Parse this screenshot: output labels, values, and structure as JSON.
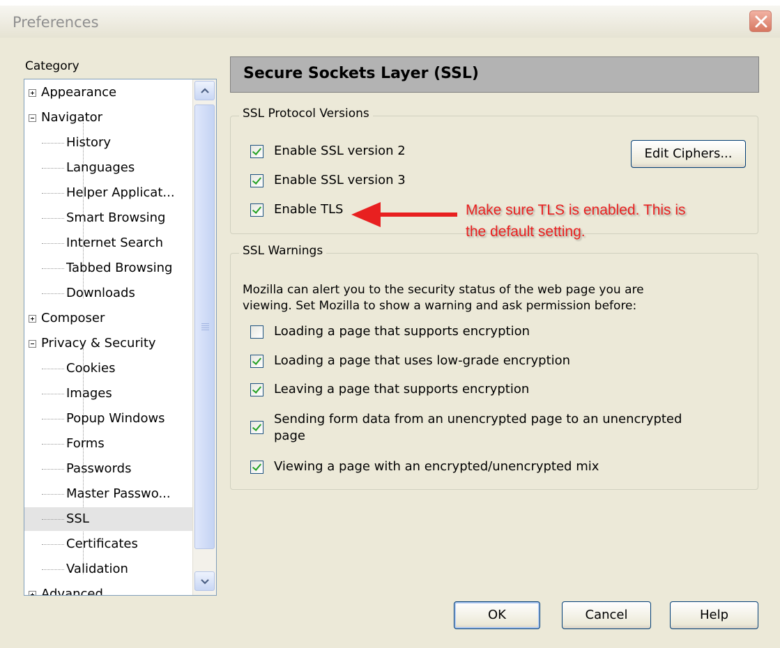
{
  "window": {
    "title": "Preferences"
  },
  "sidebar": {
    "label": "Category",
    "items": [
      {
        "label": "Appearance",
        "kind": "plus"
      },
      {
        "label": "Navigator",
        "kind": "minus"
      },
      {
        "label": "History",
        "kind": "child"
      },
      {
        "label": "Languages",
        "kind": "child"
      },
      {
        "label": "Helper Applicat...",
        "kind": "child"
      },
      {
        "label": "Smart Browsing",
        "kind": "child"
      },
      {
        "label": "Internet Search",
        "kind": "child"
      },
      {
        "label": "Tabbed Browsing",
        "kind": "child"
      },
      {
        "label": "Downloads",
        "kind": "child"
      },
      {
        "label": "Composer",
        "kind": "plus"
      },
      {
        "label": "Privacy & Security",
        "kind": "minus"
      },
      {
        "label": "Cookies",
        "kind": "child"
      },
      {
        "label": "Images",
        "kind": "child"
      },
      {
        "label": "Popup Windows",
        "kind": "child"
      },
      {
        "label": "Forms",
        "kind": "child"
      },
      {
        "label": "Passwords",
        "kind": "child"
      },
      {
        "label": "Master Passwo...",
        "kind": "child"
      },
      {
        "label": "SSL",
        "kind": "child",
        "selected": true
      },
      {
        "label": "Certificates",
        "kind": "child"
      },
      {
        "label": "Validation",
        "kind": "child"
      },
      {
        "label": "Advanced",
        "kind": "plus"
      }
    ]
  },
  "panel": {
    "title": "Secure Sockets Layer (SSL)",
    "protocols": {
      "legend": "SSL Protocol Versions",
      "edit_ciphers": "Edit Ciphers...",
      "options": [
        {
          "label": "Enable SSL version 2",
          "checked": true
        },
        {
          "label": "Enable SSL version 3",
          "checked": true
        },
        {
          "label": "Enable TLS",
          "checked": true
        }
      ]
    },
    "warnings": {
      "legend": "SSL Warnings",
      "description_line1": "Mozilla can alert you to the security status of the web page you are",
      "description_line2": "viewing. Set Mozilla to show a warning and ask permission before:",
      "options": [
        {
          "label": "Loading a page that supports encryption",
          "checked": false
        },
        {
          "label": "Loading a page that uses low-grade encryption",
          "checked": true
        },
        {
          "label": "Leaving a page that supports encryption",
          "checked": true
        },
        {
          "label_line1": "Sending form data from an unencrypted page to an unencrypted",
          "label_line2": "page",
          "checked": true
        },
        {
          "label": "Viewing a page with an encrypted/unencrypted mix",
          "checked": true
        }
      ]
    }
  },
  "annotation": {
    "line1": "Make sure TLS is enabled.  This is",
    "line2": "the default setting.",
    "color": "#e82020"
  },
  "buttons": {
    "ok": "OK",
    "cancel": "Cancel",
    "help": "Help"
  }
}
